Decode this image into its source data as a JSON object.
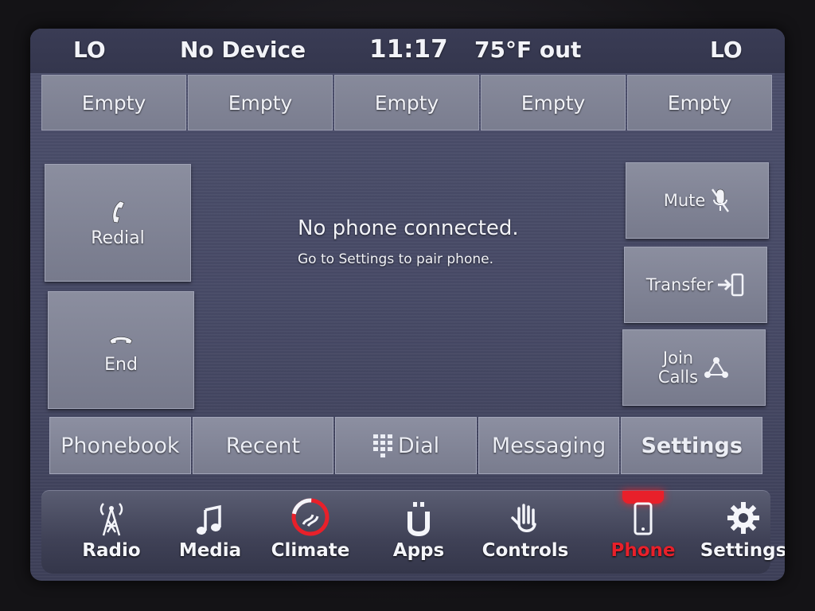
{
  "status": {
    "left_temp": "LO",
    "device": "No Device",
    "time": "11:17",
    "outside_temp": "75°F out",
    "right_temp": "LO"
  },
  "favorites": [
    "Empty",
    "Empty",
    "Empty",
    "Empty",
    "Empty"
  ],
  "call_controls": {
    "redial_label": "Redial",
    "end_label": "End",
    "mute_label": "Mute",
    "transfer_label": "Transfer",
    "join_calls_line1": "Join",
    "join_calls_line2": "Calls"
  },
  "message": {
    "title": "No phone connected.",
    "subtitle": "Go to Settings to pair phone."
  },
  "phone_tabs": [
    "Phonebook",
    "Recent",
    "Dial",
    "Messaging",
    "Settings"
  ],
  "main_nav": {
    "items": [
      "Radio",
      "Media",
      "Climate",
      "Apps",
      "Controls",
      "Phone",
      "Settings"
    ],
    "active": "Phone"
  },
  "colors": {
    "active_red": "#e8202a",
    "text": "#f2f3f8"
  },
  "icons": {
    "redial": "phone-handset-icon",
    "end": "hang-up-icon",
    "mute": "muted-microphone-icon",
    "transfer": "transfer-to-phone-icon",
    "join_calls": "join-calls-icon",
    "dial": "keypad-icon",
    "radio": "radio-tower-icon",
    "media": "music-note-icon",
    "climate": "climate-fan-icon",
    "apps": "apps-icon",
    "controls": "hand-controls-icon",
    "phone": "smartphone-icon",
    "settings": "gear-icon"
  }
}
